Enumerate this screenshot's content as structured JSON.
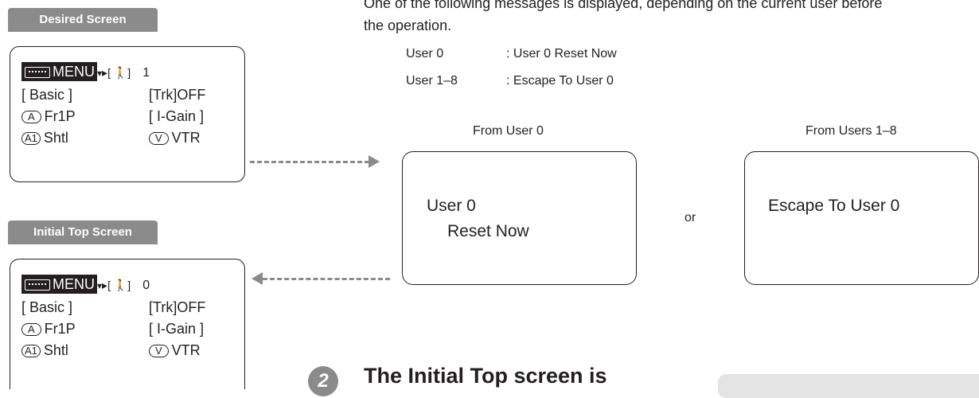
{
  "intro_text_line1": "One of the following messages is displayed, depending on the current user before",
  "intro_text_line2": "the operation.",
  "user_table": [
    {
      "user": "User 0",
      "msg": ": User 0 Reset Now"
    },
    {
      "user": "User 1–8",
      "msg": ": Escape To User 0"
    }
  ],
  "desired_screen": {
    "tab_label": "Desired Screen",
    "menu_label": "MENU",
    "menu_arrow": "▾",
    "pointer": "▸",
    "person_bracket": "[ 🚶]",
    "user_num": "1",
    "row2_left": "[ Basic ]",
    "row2_right": "[Trk]OFF",
    "row3_key": "A",
    "row3_left": "Fr1P",
    "row3_right": "[ I-Gain ]",
    "row4_key": "A1",
    "row4_left": "Shtl",
    "row4_key2": "V",
    "row4_right": "VTR"
  },
  "initial_screen": {
    "tab_label": "Initial Top Screen",
    "menu_label": "MENU",
    "menu_arrow": "▾",
    "pointer": "▸",
    "person_bracket": "[ 🚶]",
    "user_num": "0",
    "row2_left": "[ Basic ]",
    "row2_right": "[Trk]OFF",
    "row3_key": "A",
    "row3_left": "Fr1P",
    "row3_right": "[ I-Gain ]",
    "row4_key": "A1",
    "row4_left": "Shtl",
    "row4_key2": "V",
    "row4_right": "VTR"
  },
  "from_user0": {
    "caption": "From User 0",
    "line1": "User 0",
    "line2": "Reset Now"
  },
  "or_label": "or",
  "from_users18": {
    "caption": "From Users 1–8",
    "line1": "Escape To User 0"
  },
  "step": {
    "number": "2",
    "heading": "The Initial Top screen is"
  }
}
